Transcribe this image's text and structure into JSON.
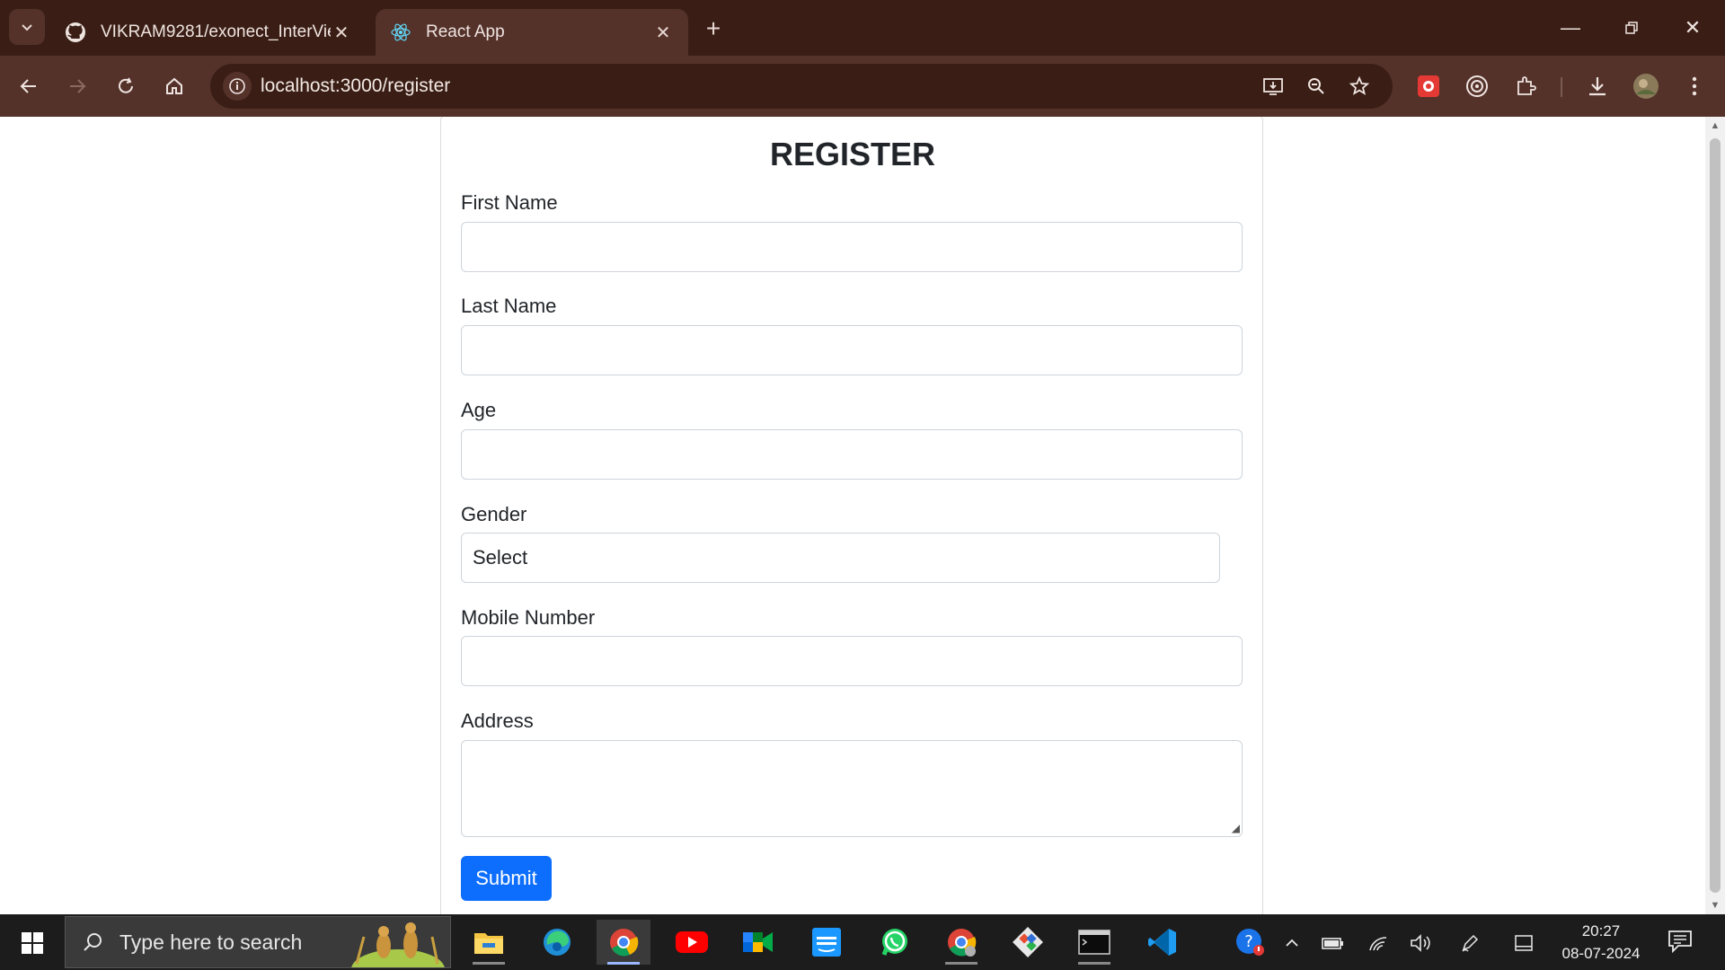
{
  "browser": {
    "tabs": [
      {
        "title": "VIKRAM9281/exonect_InterVie",
        "favicon": "github-icon",
        "active": false
      },
      {
        "title": "React App",
        "favicon": "react-icon",
        "active": true
      }
    ],
    "address": "localhost:3000/register"
  },
  "form": {
    "title": "REGISTER",
    "first_name_label": "First Name",
    "last_name_label": "Last Name",
    "age_label": "Age",
    "gender_label": "Gender",
    "gender_selected": "Select",
    "mobile_label": "Mobile Number",
    "address_label": "Address",
    "submit_label": "Submit"
  },
  "taskbar": {
    "search_placeholder": "Type here to search",
    "apps": [
      "file-explorer",
      "edge",
      "chrome",
      "youtube",
      "google-meet",
      "prime-video",
      "whatsapp",
      "chrome-profile",
      "git",
      "terminal",
      "vscode"
    ],
    "time": "20:27",
    "date": "08-07-2024"
  },
  "colors": {
    "browser_frame": "#3a1e15",
    "toolbar": "#54322a",
    "primary_button": "#0d6efd",
    "taskbar": "#1c1c1c"
  }
}
